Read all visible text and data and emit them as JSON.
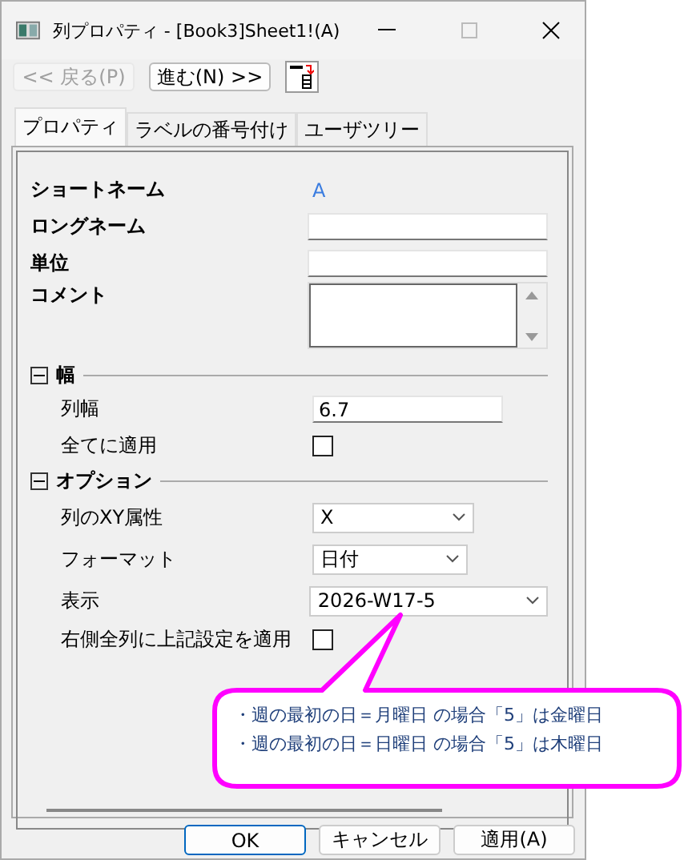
{
  "window": {
    "title": "列プロパティ - [Book3]Sheet1!(A)"
  },
  "nav_buttons": [
    {
      "label": "<< 戻る(P)",
      "disabled": true
    },
    {
      "label": "進む(N) >>",
      "disabled": false
    }
  ],
  "tabs": [
    {
      "label": "プロパティ",
      "selected": true
    },
    {
      "label": "ラベルの番号付け",
      "selected": false
    },
    {
      "label": "ユーザツリー",
      "selected": false
    }
  ],
  "fields": [
    {
      "kind": "static",
      "label": "ショートネーム",
      "value": "A"
    },
    {
      "kind": "input",
      "label": "ロングネーム"
    },
    {
      "kind": "input",
      "label": "単位"
    },
    {
      "kind": "textarea",
      "label": "コメント"
    }
  ],
  "sections": [
    {
      "label": "幅",
      "expanded": true,
      "rows": [
        {
          "kind": "input",
          "label": "列幅",
          "value": "6.7"
        },
        {
          "kind": "checkbox",
          "label": "全てに適用",
          "checked": false
        }
      ]
    },
    {
      "label": "オプション",
      "expanded": true,
      "rows": [
        {
          "kind": "select",
          "label": "列のXY属性",
          "value": "X"
        },
        {
          "kind": "select",
          "label": "フォーマット",
          "value": "日付"
        },
        {
          "kind": "select",
          "label": "表示",
          "value": "2026-W17-5"
        },
        {
          "kind": "checkbox",
          "label": "右側全列に上記設定を適用",
          "checked": false
        }
      ]
    }
  ],
  "callout": {
    "lines": [
      "・週の最初の日＝月曜日 の場合「5」は金曜日",
      "・週の最初の日＝日曜日 の場合「5」は木曜日"
    ]
  },
  "buttons": [
    {
      "label": "OK",
      "selected": true
    },
    {
      "label": "キャンセル",
      "selected": false
    },
    {
      "label": "適用(A)",
      "selected": false
    }
  ]
}
